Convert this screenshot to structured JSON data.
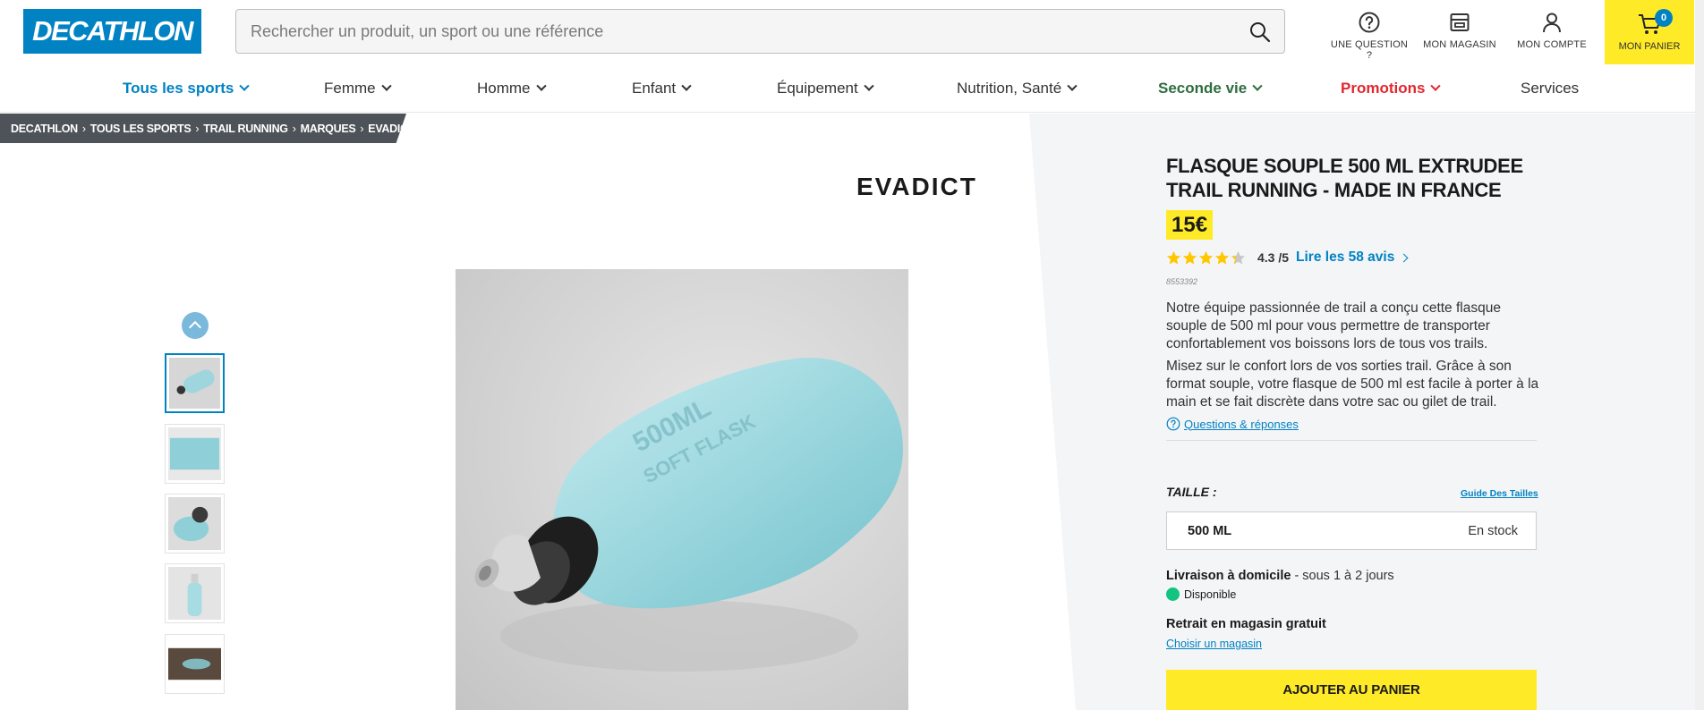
{
  "header": {
    "logo_text": "DECATHLON",
    "search_placeholder": "Rechercher un produit, un sport ou une référence",
    "question_label": "UNE QUESTION ?",
    "store_label": "MON MAGASIN",
    "account_label": "MON COMPTE",
    "cart_label": "MON PANIER",
    "cart_count": "0"
  },
  "nav": {
    "items": [
      {
        "label": "Tous les sports"
      },
      {
        "label": "Femme"
      },
      {
        "label": "Homme"
      },
      {
        "label": "Enfant"
      },
      {
        "label": "Équipement"
      },
      {
        "label": "Nutrition, Santé"
      },
      {
        "label": "Seconde vie"
      },
      {
        "label": "Promotions"
      },
      {
        "label": "Services"
      }
    ]
  },
  "breadcrumb": [
    "DECATHLON",
    "TOUS LES SPORTS",
    "TRAIL RUNNING",
    "MARQUES",
    "EVADICT"
  ],
  "brand": "EVADICT",
  "product": {
    "title": "FLASQUE SOUPLE 500 ML EXTRUDEE TRAIL RUNNING - MADE IN FRANCE",
    "price": "15€",
    "rating_score": "4.3 /5",
    "rating_value": 4.3,
    "reviews_link": "Lire les 58 avis",
    "reference": "8553392",
    "description_1": "Notre équipe passionnée de trail a conçu cette flasque souple de 500 ml pour vous permettre de transporter confortablement vos boissons lors de tous vos trails.",
    "description_2": "Misez sur le confort lors de vos sorties trail. Grâce à son format souple, votre flasque de 500 ml est facile à porter à la main et se fait discrète dans votre sac ou gilet de trail.",
    "qa_link": "Questions & réponses",
    "size_label": "TAILLE :",
    "size_guide": "Guide Des Tailles",
    "size_value": "500 ML",
    "stock_status": "En stock",
    "delivery_title": "Livraison à domicile",
    "delivery_detail": " - sous 1 à 2 jours",
    "availability": "Disponible",
    "pickup_title": "Retrait en magasin gratuit",
    "choose_store": "Choisir un magasin",
    "add_to_cart": "AJOUTER AU PANIER"
  },
  "colors": {
    "brand_blue": "#0082c3",
    "accent_yellow": "#ffea28",
    "available_green": "#12c480",
    "promo_red": "#e3262f",
    "seconde_vie_green": "#2e6e3e"
  }
}
